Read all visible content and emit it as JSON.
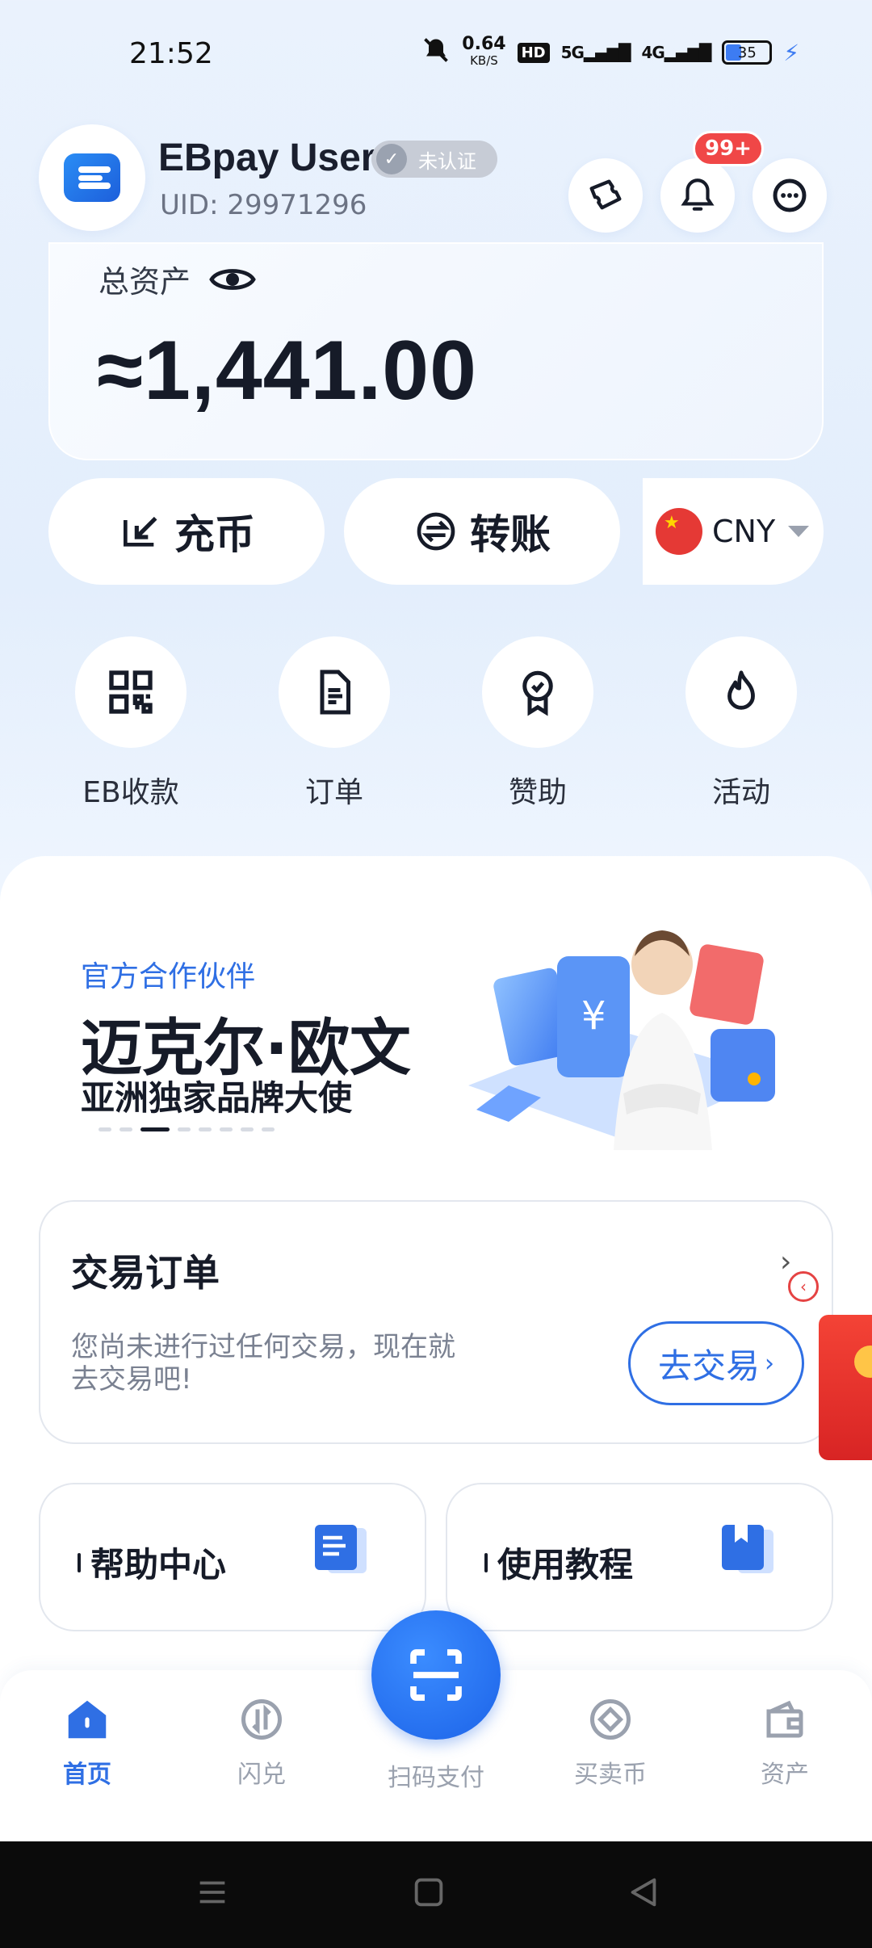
{
  "status": {
    "time": "21:52",
    "speed_value": "0.64",
    "speed_unit": "KB/S",
    "hd": "HD",
    "net1": "5G",
    "net2": "4G",
    "battery": "35"
  },
  "header": {
    "user_name": "EBpay User",
    "verify_label": "未认证",
    "uid": "UID: 29971296",
    "notification_count": "99+"
  },
  "assets": {
    "label": "总资产",
    "value": "≈1,441.00",
    "currency": "CNY"
  },
  "actions": {
    "deposit": "充币",
    "transfer": "转账"
  },
  "quick": [
    {
      "label": "EB收款",
      "icon": "qr-code-icon"
    },
    {
      "label": "订单",
      "icon": "document-icon"
    },
    {
      "label": "赞助",
      "icon": "award-badge-icon"
    },
    {
      "label": "活动",
      "icon": "flame-icon"
    }
  ],
  "banner": {
    "subtitle": "官方合作伙伴",
    "title": "迈克尔·欧文",
    "desc": "亚洲独家品牌大使",
    "active_slide": 3,
    "slide_count": 8
  },
  "orders": {
    "title": "交易订单",
    "empty_text": "您尚未进行过任何交易，现在就去交易吧!",
    "button": "去交易"
  },
  "cards": {
    "help": "帮助中心",
    "tutorial": "使用教程"
  },
  "nav": {
    "home": "首页",
    "swap": "闪兑",
    "scan": "扫码支付",
    "trade": "买卖币",
    "assets": "资产"
  },
  "colors": {
    "accent": "#2f6fe4",
    "badge": "#f04747"
  }
}
